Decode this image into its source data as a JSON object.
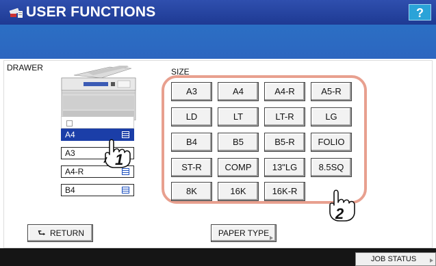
{
  "header": {
    "title": "USER FUNCTIONS",
    "help_label": "?"
  },
  "drawer": {
    "label": "DRAWER",
    "items": [
      {
        "label": "A4",
        "selected": true
      },
      {
        "label": "A3",
        "selected": false
      },
      {
        "label": "A4-R",
        "selected": false
      },
      {
        "label": "B4",
        "selected": false
      }
    ]
  },
  "size": {
    "label": "SIZE",
    "rows": [
      [
        "A3",
        "A4",
        "A4-R",
        "A5-R"
      ],
      [
        "LD",
        "LT",
        "LT-R",
        "LG"
      ],
      [
        "B4",
        "B5",
        "B5-R",
        "FOLIO"
      ],
      [
        "ST-R",
        "COMP",
        "13\"LG",
        "8.5SQ"
      ],
      [
        "8K",
        "16K",
        "16K-R"
      ]
    ]
  },
  "callouts": {
    "one": "1",
    "two": "2"
  },
  "footer": {
    "return_label": "RETURN",
    "return_icon": "return-arrow-icon",
    "paper_type_label": "PAPER TYPE",
    "job_status_label": "JOB STATUS"
  },
  "colors": {
    "title_bar": "#1e3a93",
    "sub_bar": "#2b6fc4",
    "selected_drawer": "#1b3ea8",
    "highlight_box": "#e8a08f",
    "help_button": "#2aa3d8"
  }
}
